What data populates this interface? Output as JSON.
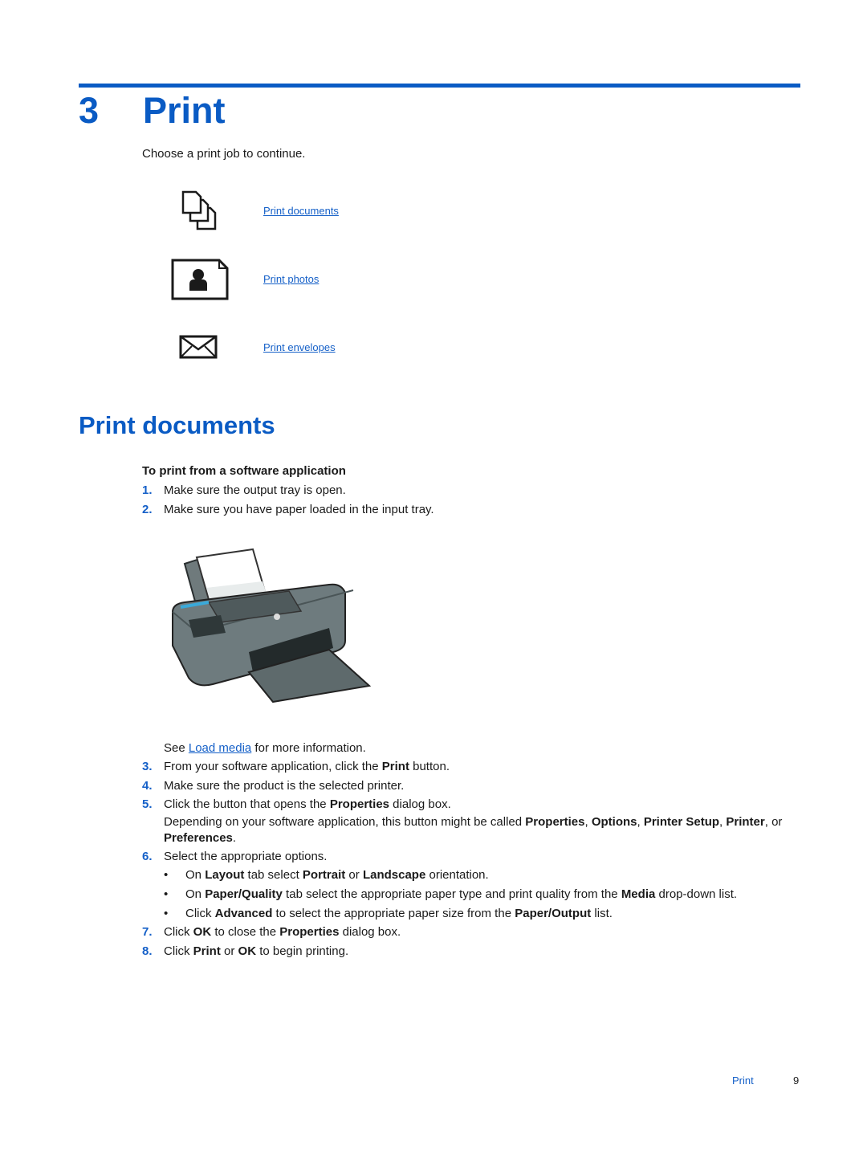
{
  "chapter": {
    "number": "3",
    "title": "Print"
  },
  "intro": "Choose a print job to continue.",
  "print_jobs": [
    {
      "icon": "documents-icon",
      "label": "Print documents"
    },
    {
      "icon": "photo-icon",
      "label": "Print photos"
    },
    {
      "icon": "envelope-icon",
      "label": "Print envelopes"
    }
  ],
  "section": {
    "title": "Print documents",
    "subheading": "To print from a software application",
    "steps": [
      {
        "n": "1.",
        "text": "Make sure the output tray is open."
      },
      {
        "n": "2.",
        "text": "Make sure you have paper loaded in the input tray."
      },
      {
        "n": "3.",
        "pre": "From your software application, click the ",
        "bold": "Print",
        "post": " button."
      },
      {
        "n": "4.",
        "text": "Make sure the product is the selected printer."
      },
      {
        "n": "5.",
        "pre": "Click the button that opens the ",
        "bold": "Properties",
        "post": " dialog box."
      },
      {
        "n": "6.",
        "text": "Select the appropriate options."
      },
      {
        "n": "7.",
        "pre": "Click ",
        "bold": "OK",
        "mid": " to close the ",
        "bold2": "Properties",
        "post": " dialog box."
      },
      {
        "n": "8.",
        "pre": "Click ",
        "bold": "Print",
        "mid": " or ",
        "bold2": "OK",
        "post": " to begin printing."
      }
    ],
    "see_also": {
      "pre": "See ",
      "link": "Load media",
      "post": " for more information."
    },
    "step5_note": {
      "pre": "Depending on your software application, this button might be called ",
      "b1": "Properties",
      "s1": ", ",
      "b2": "Options",
      "s2": ", ",
      "b3": "Printer Setup",
      "s3": ", ",
      "b4": "Printer",
      "s4": ", or ",
      "b5": "Preferences",
      "s5": "."
    },
    "bullets": [
      {
        "pre": "On ",
        "b1": "Layout",
        "m1": " tab select ",
        "b2": "Portrait",
        "m2": " or ",
        "b3": "Landscape",
        "post": " orientation."
      },
      {
        "pre": "On ",
        "b1": "Paper/Quality",
        "m1": " tab select the appropriate paper type and print quality from the ",
        "b2": "Media",
        "post": " drop-down list."
      },
      {
        "pre": "Click ",
        "b1": "Advanced",
        "m1": " to select the appropriate paper size from the ",
        "b2": "Paper/Output",
        "post": " list."
      }
    ],
    "bullet_glyph": "•",
    "image_alt": "printer-illustration"
  },
  "footer": {
    "section": "Print",
    "page": "9"
  }
}
